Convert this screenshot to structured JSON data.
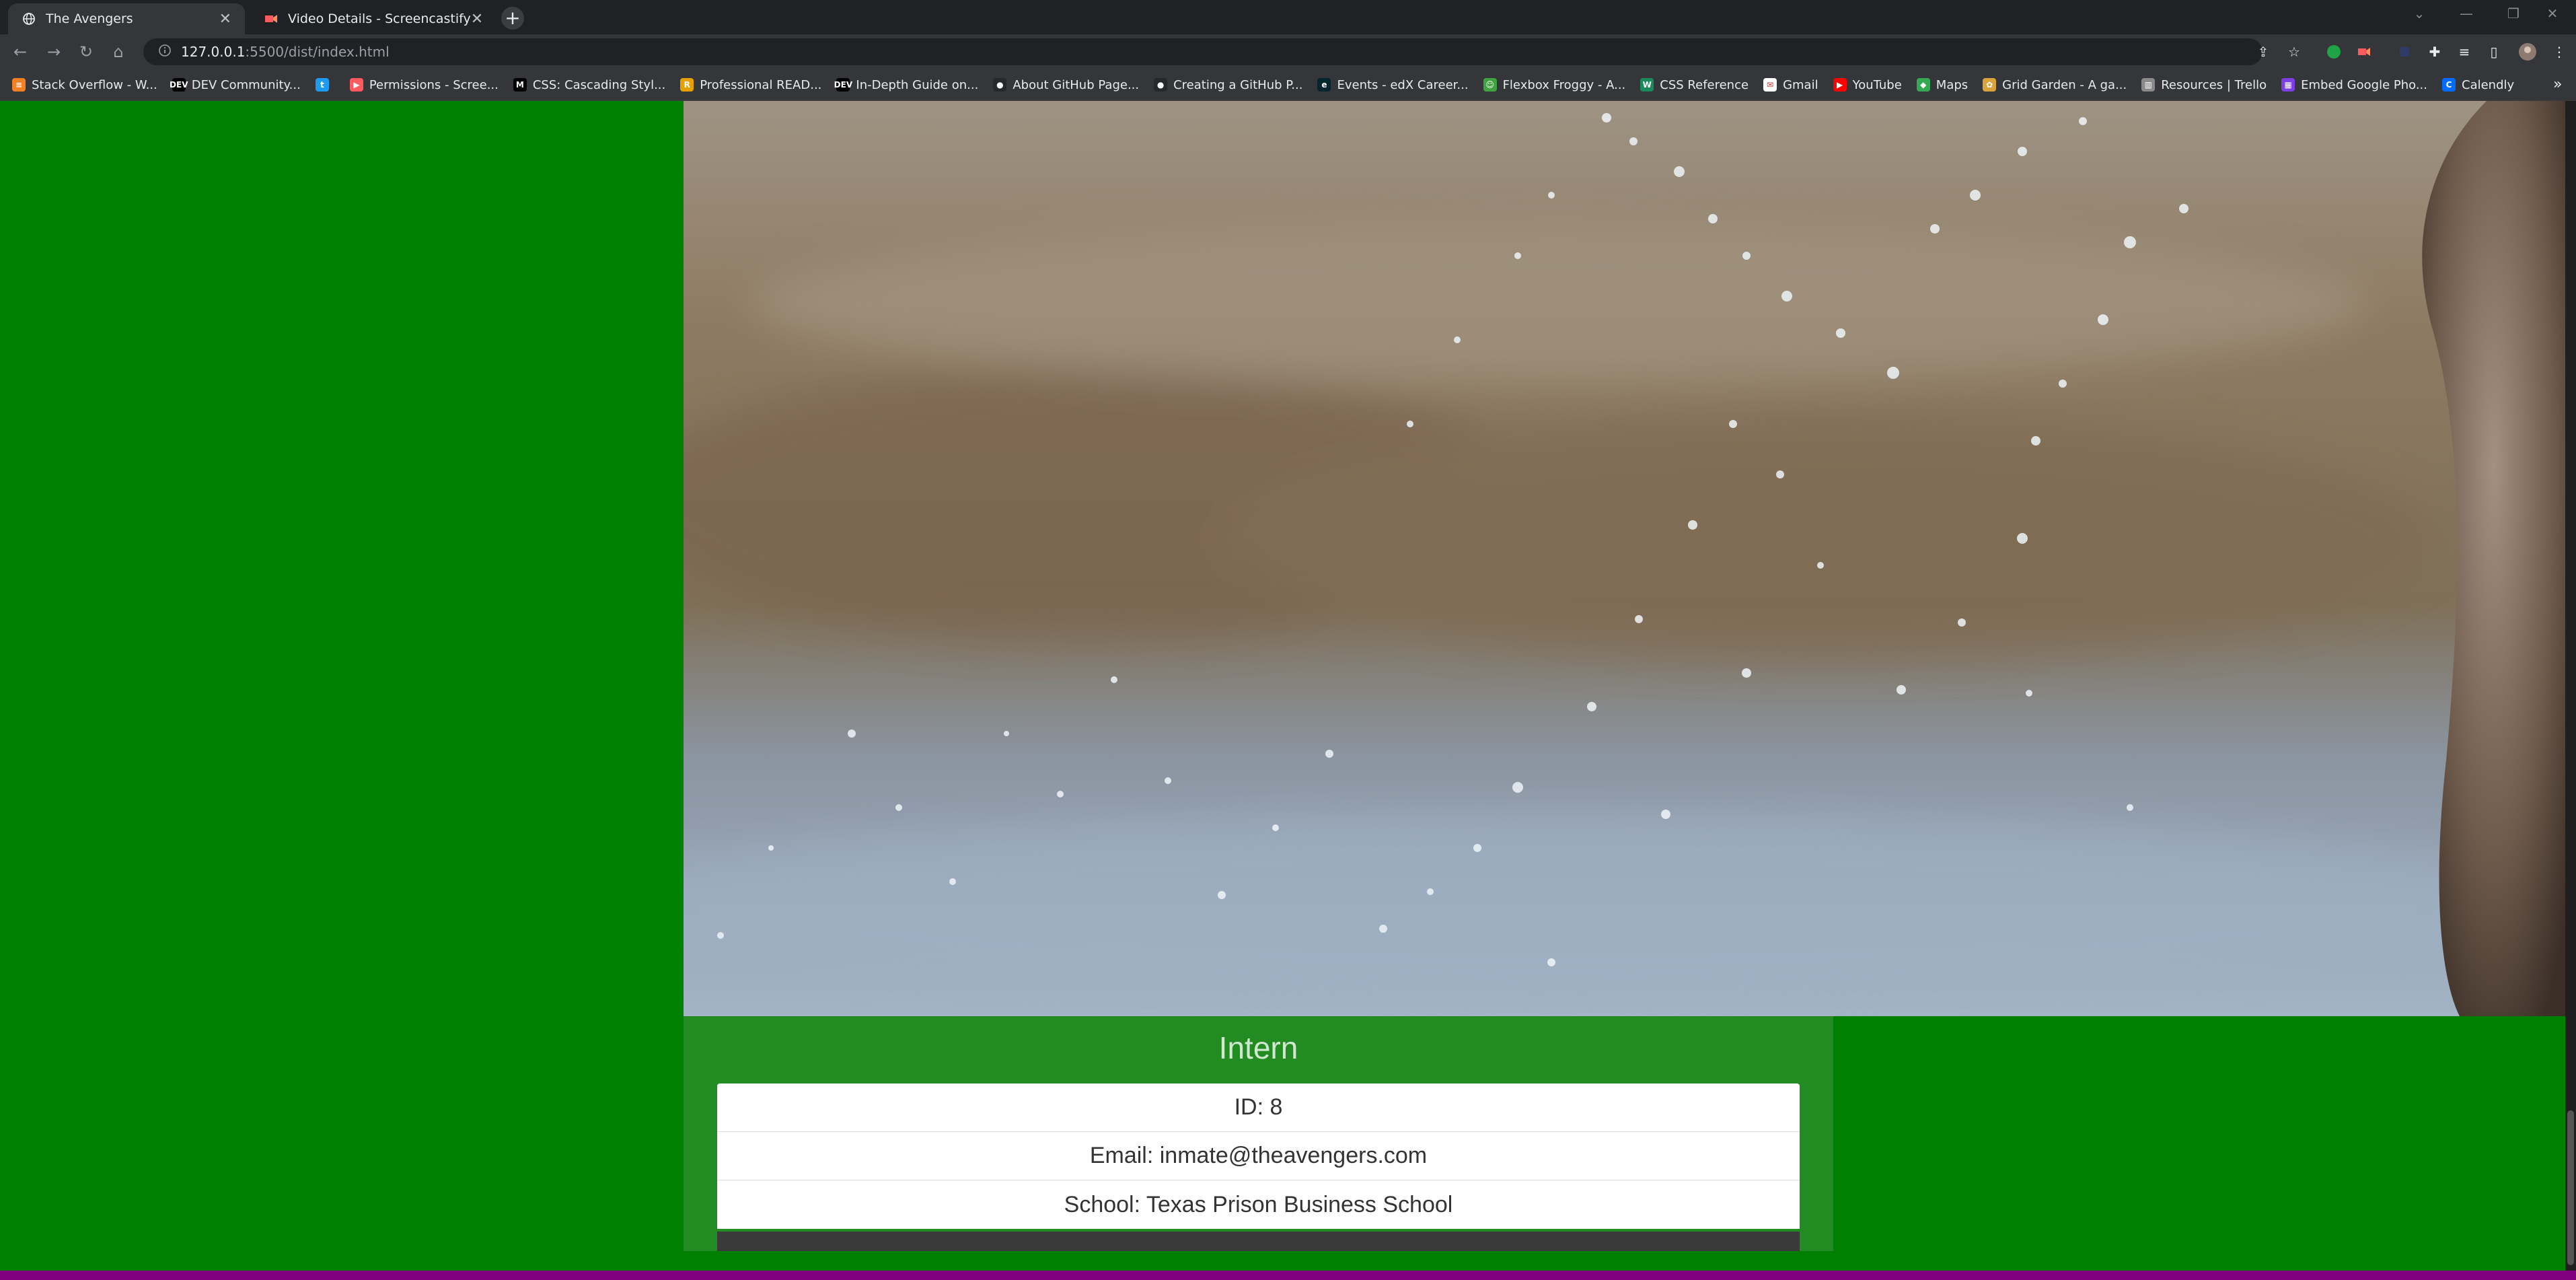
{
  "browser": {
    "tabs": [
      {
        "title": "The Avengers",
        "active": true,
        "favicon": "globe-icon"
      },
      {
        "title": "Video Details - Screencastify",
        "active": false,
        "favicon": "screencastify-icon"
      }
    ],
    "new_tab": "+",
    "close_glyph": "✕",
    "url_host": "127.0.0.1",
    "url_path": ":5500/dist/index.html"
  },
  "bookmarks": [
    {
      "label": "Stack Overflow - W...",
      "icon": "stackoverflow-icon",
      "color": "#f48024",
      "glyph": "≡"
    },
    {
      "label": "DEV Community...",
      "icon": "dev-icon",
      "color": "#000000",
      "glyph": "DEV"
    },
    {
      "label": "",
      "icon": "twitter-icon",
      "color": "#1d9bf0",
      "glyph": "t"
    },
    {
      "label": "Permissions - Scree...",
      "icon": "screencastify-icon",
      "color": "#ff5a5f",
      "glyph": "▶"
    },
    {
      "label": "CSS: Cascading Styl...",
      "icon": "mdn-icon",
      "color": "#000000",
      "glyph": "M"
    },
    {
      "label": "Professional READ...",
      "icon": "readme-icon",
      "color": "#e6a100",
      "glyph": "R"
    },
    {
      "label": "In-Depth Guide on...",
      "icon": "dev-icon",
      "color": "#000000",
      "glyph": "DEV"
    },
    {
      "label": "About GitHub Page...",
      "icon": "github-icon",
      "color": "#24292e",
      "glyph": "●"
    },
    {
      "label": "Creating a GitHub P...",
      "icon": "github-icon",
      "color": "#24292e",
      "glyph": "●"
    },
    {
      "label": "Events - edX Career...",
      "icon": "edx-icon",
      "color": "#02262b",
      "glyph": "e"
    },
    {
      "label": "Flexbox Froggy - A...",
      "icon": "froggy-icon",
      "color": "#3fa33f",
      "glyph": "☺"
    },
    {
      "label": "CSS Reference",
      "icon": "css-reference-icon",
      "color": "#1b8a5a",
      "glyph": "W"
    },
    {
      "label": "Gmail",
      "icon": "gmail-icon",
      "color": "#ffffff",
      "glyph": "✉"
    },
    {
      "label": "YouTube",
      "icon": "youtube-icon",
      "color": "#ff0000",
      "glyph": "▶"
    },
    {
      "label": "Maps",
      "icon": "maps-icon",
      "color": "#34a853",
      "glyph": "◆"
    },
    {
      "label": "Grid Garden - A ga...",
      "icon": "grid-garden-icon",
      "color": "#d9a43c",
      "glyph": "✿"
    },
    {
      "label": "Resources | Trello",
      "icon": "trello-icon",
      "color": "#8a8a8a",
      "glyph": "▥"
    },
    {
      "label": "Embed Google Pho...",
      "icon": "google-photos-icon",
      "color": "#7b3fe4",
      "glyph": "▦"
    },
    {
      "label": "Calendly",
      "icon": "calendly-icon",
      "color": "#006bff",
      "glyph": "C"
    }
  ],
  "bookmarks_more": "»",
  "card": {
    "title": "Intern",
    "id_line": "ID: 8",
    "email_line": "Email: inmate@theavengers.com",
    "school_line": "School: Texas Prison Business School"
  },
  "colors": {
    "page_background": "#008000",
    "card_background": "#228b22",
    "footer_bar": "#800080"
  }
}
